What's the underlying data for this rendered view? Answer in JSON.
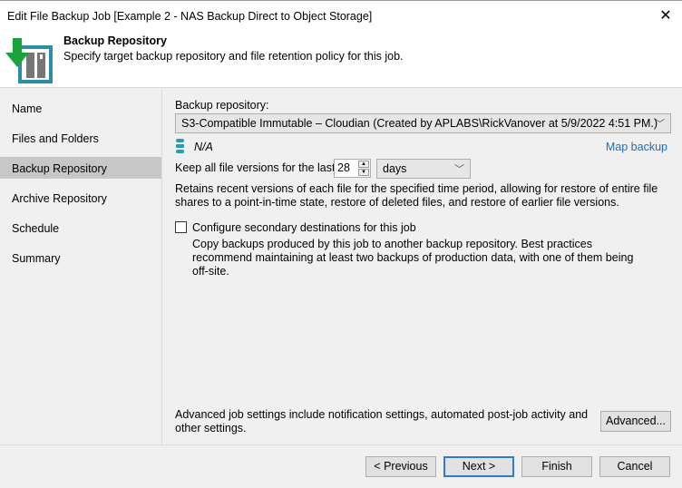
{
  "window": {
    "title": "Edit File Backup Job [Example 2 - NAS Backup Direct to Object Storage]",
    "close_icon": "close-icon"
  },
  "header": {
    "title": "Backup Repository",
    "subtitle": "Specify target backup repository and file retention policy for this job."
  },
  "sidebar": {
    "items": [
      {
        "label": "Name"
      },
      {
        "label": "Files and Folders"
      },
      {
        "label": "Backup Repository",
        "selected": true
      },
      {
        "label": "Archive Repository"
      },
      {
        "label": "Schedule"
      },
      {
        "label": "Summary"
      }
    ]
  },
  "main": {
    "repo_label": "Backup repository:",
    "repo_value": "S3-Compatible Immutable – Cloudian (Created by APLABS\\RickVanover at 5/9/2022 4:51 PM.)",
    "repo_size": "N/A",
    "map_backup": "Map backup",
    "keep_label": "Keep all file versions for the last:",
    "keep_value": "28",
    "keep_unit": "days",
    "retain_desc": "Retains recent versions of each file for the specified time period, allowing for restore of entire file shares to a point-in-time state, restore of deleted files, and restore of earlier file versions.",
    "secondary_label": "Configure secondary destinations for this job",
    "secondary_checked": false,
    "secondary_desc": "Copy backups produced by this job to another backup repository. Best practices recommend maintaining at least two backups of production data, with one of them being off-site.",
    "advanced_desc": "Advanced job settings include notification settings, automated post-job activity and other settings.",
    "advanced_button": "Advanced..."
  },
  "footer": {
    "previous": "< Previous",
    "next": "Next >",
    "finish": "Finish",
    "cancel": "Cancel"
  },
  "colors": {
    "accent": "#1b6fbf",
    "selected": "#c7c7c7",
    "icon_teal": "#2a8fa5",
    "icon_green": "#1aa33a"
  }
}
